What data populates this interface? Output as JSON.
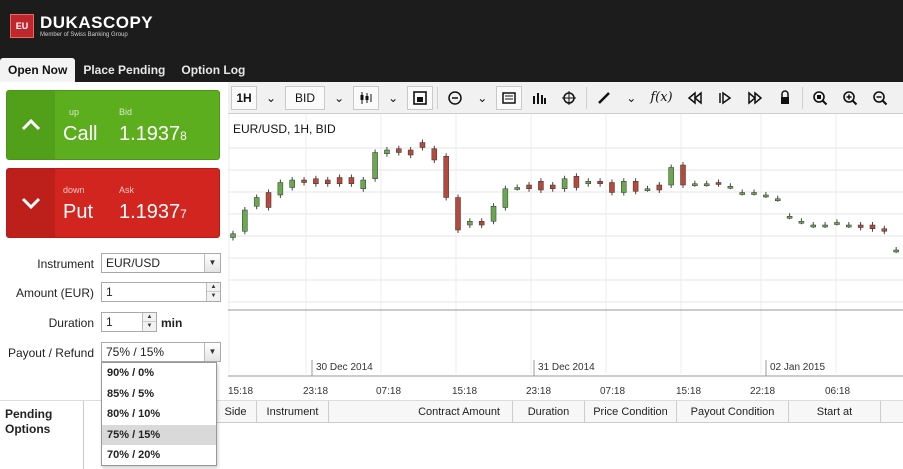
{
  "brand": {
    "logo_badge": "EU",
    "name": "DUKASCOPY",
    "tagline": "Member of Swiss Banking Group"
  },
  "tabs": [
    {
      "label": "Open Now",
      "active": true
    },
    {
      "label": "Place Pending",
      "active": false
    },
    {
      "label": "Option Log",
      "active": false
    }
  ],
  "call": {
    "direction": "up",
    "label": "Call",
    "price_label": "Bid",
    "price_main": "1.1937",
    "price_pip": "8",
    "color": "#5cae1f"
  },
  "put": {
    "direction": "down",
    "label": "Put",
    "price_label": "Ask",
    "price_main": "1.1937",
    "price_pip": "7",
    "color": "#d2251f"
  },
  "form": {
    "instrument_label": "Instrument",
    "instrument_value": "EUR/USD",
    "amount_label": "Amount (EUR)",
    "amount_value": "1",
    "duration_label": "Duration",
    "duration_value": "1",
    "duration_unit": "min",
    "payout_label": "Payout / Refund",
    "payout_value": "75% / 15%"
  },
  "payout_options": [
    {
      "label": "90% / 0%",
      "selected": false
    },
    {
      "label": "85% / 5%",
      "selected": false
    },
    {
      "label": "80% / 10%",
      "selected": false
    },
    {
      "label": "75% / 15%",
      "selected": true
    },
    {
      "label": "70% / 20%",
      "selected": false
    }
  ],
  "toolbar": {
    "period": "1H",
    "price_type": "BID",
    "icons": [
      "candle-type-icon",
      "add-chart-icon",
      "theme-icon",
      "template-icon",
      "volume-icon",
      "crosshair-icon",
      "pencil-icon",
      "function-icon",
      "rewind-icon",
      "step-icon",
      "forward-icon",
      "lock-icon",
      "zoom-fit-icon",
      "zoom-in-icon",
      "zoom-out-icon"
    ]
  },
  "chart": {
    "title": "EUR/USD, 1H, BID",
    "date_labels": [
      "30 Dec 2014",
      "31 Dec 2014",
      "02 Jan 2015"
    ],
    "time_labels": [
      "15:18",
      "23:18",
      "07:18",
      "15:18",
      "23:18",
      "07:18",
      "15:18",
      "22:18",
      "06:18"
    ],
    "up_color": "#6aa84f",
    "down_color": "#b54a3c"
  },
  "chart_data": {
    "type": "candlestick",
    "title": "EUR/USD, 1H, BID",
    "xlabel": "",
    "ylabel": "",
    "x_tick_labels": [
      "15:18",
      "23:18",
      "07:18",
      "15:18",
      "23:18",
      "07:18",
      "15:18",
      "22:18",
      "06:18"
    ],
    "candles": [
      {
        "o": 1.0,
        "c": 1.3
      },
      {
        "o": 1.5,
        "c": 3.2
      },
      {
        "o": 3.5,
        "c": 4.2
      },
      {
        "o": 4.6,
        "c": 3.4
      },
      {
        "o": 4.4,
        "c": 5.4
      },
      {
        "o": 5.0,
        "c": 5.6
      },
      {
        "o": 5.6,
        "c": 5.4
      },
      {
        "o": 5.7,
        "c": 5.3
      },
      {
        "o": 5.6,
        "c": 5.3
      },
      {
        "o": 5.8,
        "c": 5.3
      },
      {
        "o": 5.8,
        "c": 5.3
      },
      {
        "o": 4.9,
        "c": 5.6
      },
      {
        "o": 5.7,
        "c": 7.8
      },
      {
        "o": 7.7,
        "c": 8.0
      },
      {
        "o": 8.1,
        "c": 7.8
      },
      {
        "o": 8.0,
        "c": 7.6
      },
      {
        "o": 8.6,
        "c": 8.2
      },
      {
        "o": 8.1,
        "c": 7.2
      },
      {
        "o": 7.5,
        "c": 4.2
      },
      {
        "o": 4.2,
        "c": 1.6
      },
      {
        "o": 2.0,
        "c": 2.3
      },
      {
        "o": 2.3,
        "c": 2.0
      },
      {
        "o": 2.3,
        "c": 3.5
      },
      {
        "o": 3.4,
        "c": 4.9
      },
      {
        "o": 5.0,
        "c": 5.0
      },
      {
        "o": 5.2,
        "c": 4.9
      },
      {
        "o": 5.5,
        "c": 4.8
      },
      {
        "o": 5.2,
        "c": 4.9
      },
      {
        "o": 4.9,
        "c": 5.7
      },
      {
        "o": 5.9,
        "c": 5.0
      },
      {
        "o": 5.3,
        "c": 5.5
      },
      {
        "o": 5.5,
        "c": 5.3
      },
      {
        "o": 5.4,
        "c": 4.6
      },
      {
        "o": 4.6,
        "c": 5.5
      },
      {
        "o": 5.5,
        "c": 4.7
      },
      {
        "o": 4.9,
        "c": 4.9
      },
      {
        "o": 5.2,
        "c": 4.8
      },
      {
        "o": 5.2,
        "c": 6.6
      },
      {
        "o": 6.8,
        "c": 5.2
      },
      {
        "o": 5.3,
        "c": 5.3
      },
      {
        "o": 5.3,
        "c": 5.3
      },
      {
        "o": 5.4,
        "c": 5.3
      },
      {
        "o": 5.1,
        "c": 5.1
      },
      {
        "o": 4.6,
        "c": 4.6
      },
      {
        "o": 4.6,
        "c": 4.6
      },
      {
        "o": 4.4,
        "c": 4.4
      },
      {
        "o": 4.1,
        "c": 4.1
      },
      {
        "o": 2.7,
        "c": 2.7
      },
      {
        "o": 2.3,
        "c": 2.3
      },
      {
        "o": 2.0,
        "c": 2.0
      },
      {
        "o": 2.0,
        "c": 2.0
      },
      {
        "o": 2.2,
        "c": 2.2
      },
      {
        "o": 2.0,
        "c": 2.0
      },
      {
        "o": 2.0,
        "c": 1.8
      },
      {
        "o": 2.0,
        "c": 1.7
      },
      {
        "o": 1.7,
        "c": 1.5
      },
      {
        "o": 0.0,
        "c": 0.0
      }
    ]
  },
  "pending": {
    "label": "Pending Options",
    "columns": [
      "Side",
      "Instrument",
      "Contract Amount",
      "Duration",
      "Price Condition",
      "Payout Condition",
      "Start at"
    ]
  }
}
